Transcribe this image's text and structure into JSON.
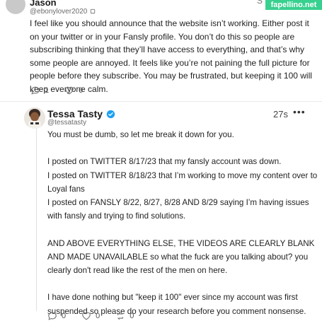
{
  "watermark": "fapellino.net",
  "top_glyph": "S",
  "post1": {
    "author": "Jason",
    "handle": "@ebonylover2020",
    "body": "I feel like you should announce that the website isn’t working. Either post it on your twitter or in your Fansly profile. You don’t do this so people are subscribing thinking that they’ll have access to everything, and that’s why some people are annoyed. It feels like you’re not paining the full picture for people before they subscribe. You may be frustrated, but keeping it 100 will keep everyone calm.",
    "reply_count": "1",
    "like_count": "0"
  },
  "post2": {
    "author": "Tessa Tasty",
    "handle": "@tessatasty",
    "time": "27s",
    "more": "•••",
    "paragraphs": [
      "You must be dumb, so let me break it down for you.",
      "",
      "I posted on TWITTER 8/17/23 that my fansly account was down.",
      "I posted on TWITTER 8/18/23 that I’m working to move my content over to Loyal fans",
      "I posted on FANSLY 8/22, 8/27, 8/28 AND 8/29 saying I’m having issues with fansly and trying to find solutions.",
      "",
      "AND ABOVE EVERYTHING ELSE, THE VIDEOS ARE CLEARLY BLANK AND MADE UNAVAILABLE so what the fuck are you talking about? you clearly don't read like the rest of the men on here.",
      "",
      "I have done nothing but \"keep it 100\" ever since my account was first suspended so please do your research before you comment nonsense."
    ],
    "reply_count": "0",
    "like_count": "0",
    "repost_count": "0"
  },
  "colors": {
    "watermark_bg": "#38d08f",
    "verified": "#1da1f2",
    "icon_gray": "#6f6f6f"
  },
  "icons": {
    "reply": "comment-bubble-icon",
    "like": "heart-icon",
    "repost": "repost-icon",
    "verified": "verified-badge-icon"
  }
}
